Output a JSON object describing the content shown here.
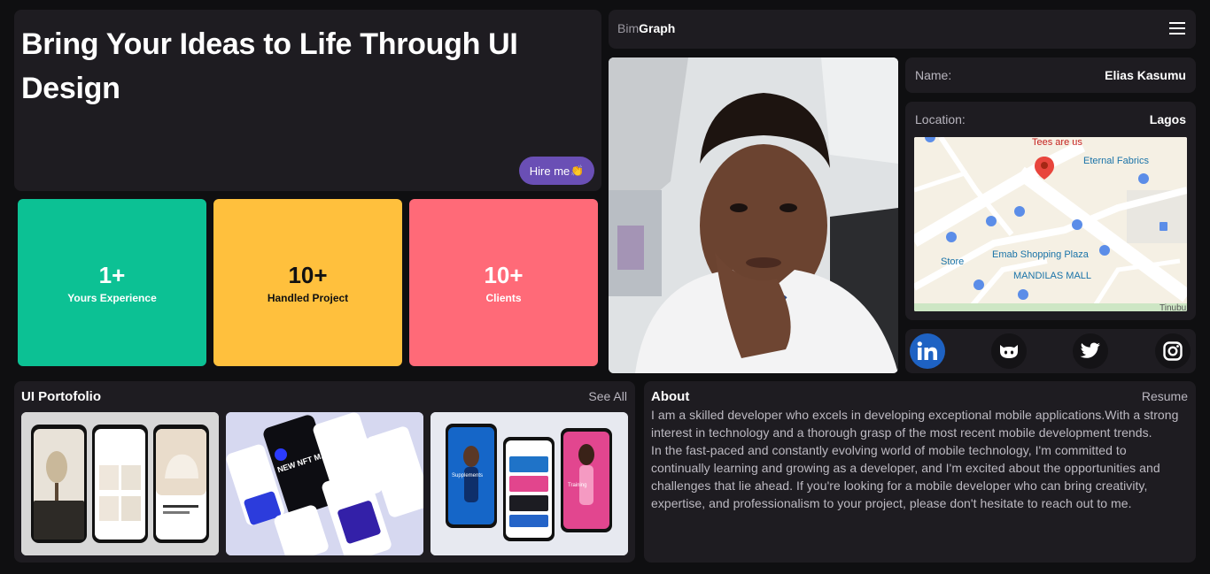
{
  "hero": {
    "headline": "Bring Your Ideas to Life Through UI Design",
    "hire_label": "Hire me",
    "hire_emoji": "👏"
  },
  "stats": [
    {
      "value": "1+",
      "label": "Yours Experience",
      "color": "#0cc194"
    },
    {
      "value": "10+",
      "label": "Handled Project",
      "color": "#ffc03d"
    },
    {
      "value": "10+",
      "label": "Clients",
      "color": "#ff6a78"
    }
  ],
  "header": {
    "brand_prefix": "Bim",
    "brand_suffix": "Graph",
    "menu_icon": "hamburger-icon"
  },
  "profile": {
    "name_key": "Name:",
    "name_value": "Elias Kasumu",
    "location_key": "Location:",
    "location_value": "Lagos"
  },
  "map": {
    "labels": [
      "Tees are us",
      "Eternal Fabrics",
      "Emab Shopping Plaza",
      "Store",
      "MANDILAS MALL",
      "Tinubu S"
    ]
  },
  "social": [
    {
      "name": "linkedin-icon",
      "color": "#1e62c3"
    },
    {
      "name": "github-icon"
    },
    {
      "name": "twitter-icon"
    },
    {
      "name": "instagram-icon"
    }
  ],
  "portfolio": {
    "title": "UI Portofolio",
    "link": "See All",
    "thumb2_text": "NEW NFT MARKET PLACE",
    "thumb3_label_a": "Supplements",
    "thumb3_label_b": "Training"
  },
  "about": {
    "title": "About",
    "link": "Resume",
    "paragraph1": "I am a skilled developer who excels in developing exceptional mobile applications.With a strong interest in technology and a thorough grasp of the most recent mobile development trends.",
    "paragraph2": "In the fast-paced and constantly evolving world of mobile technology, I'm committed to continually learning and growing as a developer, and I'm excited about the opportunities and challenges that lie ahead. If you're looking for a mobile developer who can bring creativity, expertise, and professionalism to your project, please don't hesitate to reach out to me."
  }
}
